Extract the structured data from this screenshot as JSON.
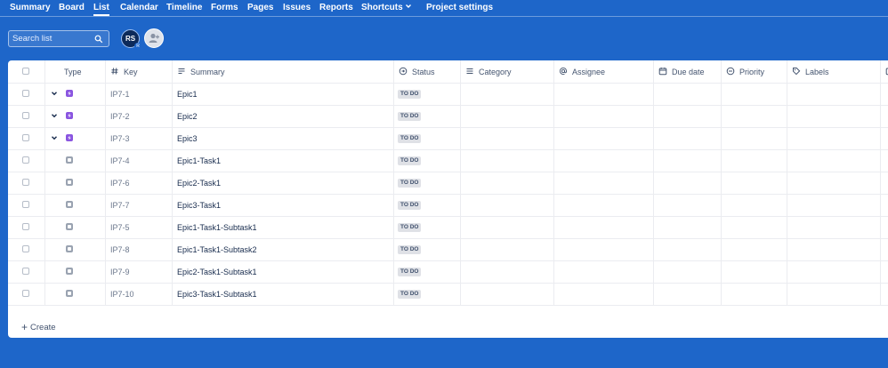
{
  "nav": {
    "items": [
      "Summary",
      "Board",
      "List",
      "Calendar",
      "Timeline",
      "Forms",
      "Pages",
      "Issues",
      "Reports",
      "Shortcuts",
      "Project settings"
    ],
    "active": "List"
  },
  "search": {
    "placeholder": "Search list"
  },
  "avatar": {
    "initials": "RS",
    "sub": "R"
  },
  "table": {
    "headers": {
      "type": "Type",
      "key": "Key",
      "summary": "Summary",
      "status": "Status",
      "category": "Category",
      "assignee": "Assignee",
      "due_date": "Due date",
      "priority": "Priority",
      "labels": "Labels"
    },
    "rows": [
      {
        "type": "epic",
        "expandable": true,
        "key": "IP7-1",
        "summary": "Epic1",
        "status": "TO DO"
      },
      {
        "type": "epic",
        "expandable": true,
        "key": "IP7-2",
        "summary": "Epic2",
        "status": "TO DO"
      },
      {
        "type": "epic",
        "expandable": true,
        "key": "IP7-3",
        "summary": "Epic3",
        "status": "TO DO"
      },
      {
        "type": "task",
        "expandable": false,
        "key": "IP7-4",
        "summary": "Epic1-Task1",
        "status": "TO DO"
      },
      {
        "type": "task",
        "expandable": false,
        "key": "IP7-6",
        "summary": "Epic2-Task1",
        "status": "TO DO"
      },
      {
        "type": "task",
        "expandable": false,
        "key": "IP7-7",
        "summary": "Epic3-Task1",
        "status": "TO DO"
      },
      {
        "type": "task",
        "expandable": false,
        "key": "IP7-5",
        "summary": "Epic1-Task1-Subtask1",
        "status": "TO DO"
      },
      {
        "type": "task",
        "expandable": false,
        "key": "IP7-8",
        "summary": "Epic1-Task1-Subtask2",
        "status": "TO DO"
      },
      {
        "type": "task",
        "expandable": false,
        "key": "IP7-9",
        "summary": "Epic2-Task1-Subtask1",
        "status": "TO DO"
      },
      {
        "type": "task",
        "expandable": false,
        "key": "IP7-10",
        "summary": "Epic3-Task1-Subtask1",
        "status": "TO DO"
      }
    ]
  },
  "create": {
    "label": "Create"
  },
  "colors": {
    "background": "#1e66c9",
    "epic": "#8a55e0",
    "task": "#9aa3b1",
    "status_bg": "#dfe1e6"
  }
}
